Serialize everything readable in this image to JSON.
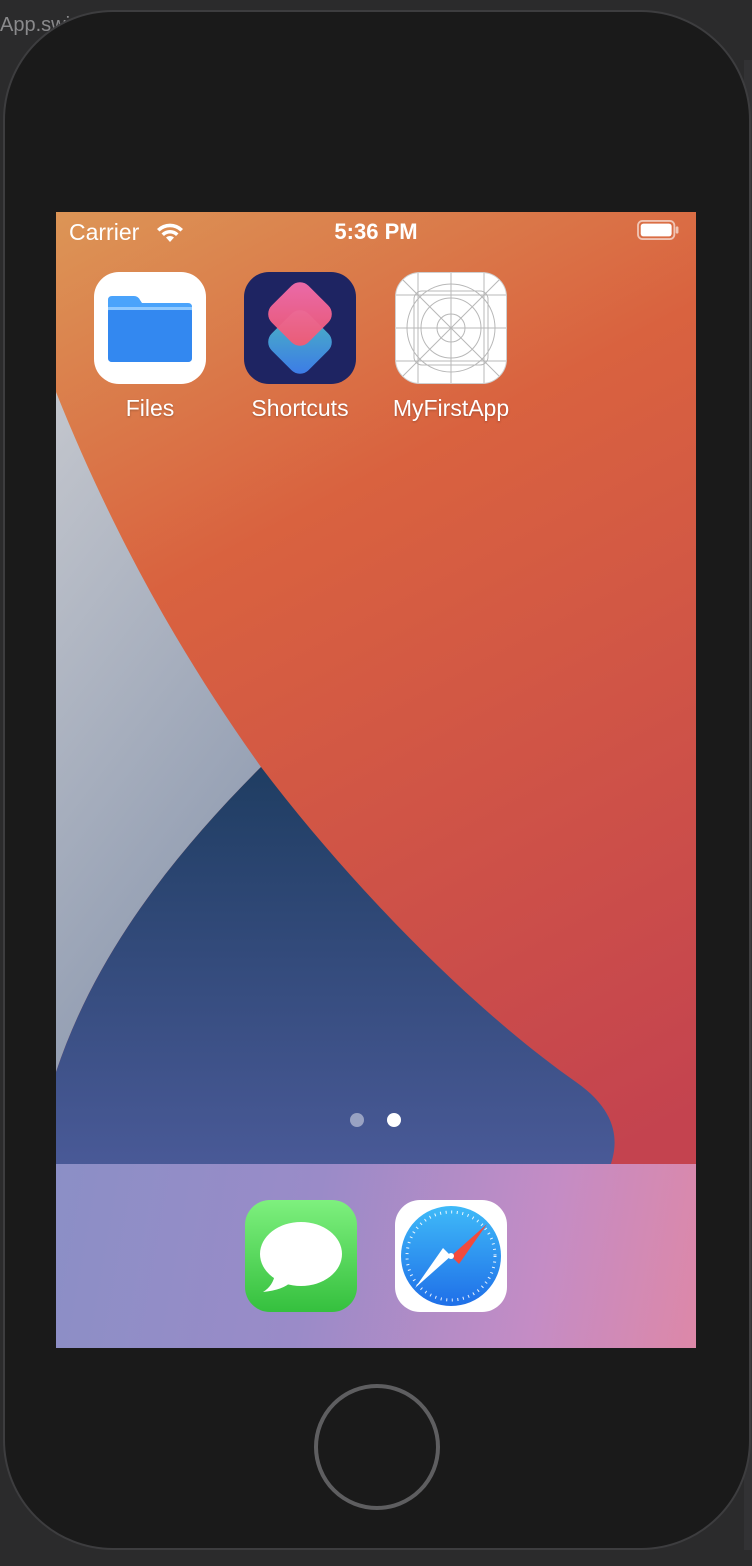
{
  "ide": {
    "tab_fragment": "App.swi"
  },
  "status_bar": {
    "carrier": "Carrier",
    "time": "5:36 PM",
    "wifi_icon": "wifi-icon",
    "battery_icon": "battery-icon"
  },
  "home_screen": {
    "apps": [
      {
        "label": "Files",
        "icon": "folder-icon"
      },
      {
        "label": "Shortcuts",
        "icon": "shortcuts-icon"
      },
      {
        "label": "MyFirstApp",
        "icon": "app-placeholder-icon"
      }
    ],
    "page_indicator": {
      "pages": 2,
      "current": 2
    }
  },
  "dock": {
    "apps": [
      {
        "name": "Messages",
        "icon": "messages-icon"
      },
      {
        "name": "Safari",
        "icon": "compass-icon"
      }
    ]
  },
  "device": {
    "home_button_icon": "home-button"
  },
  "colors": {
    "wallpaper_orange": "#d96a3c",
    "wallpaper_red": "#c9474a",
    "wallpaper_blue": "#2c4c78",
    "wallpaper_grey": "#aab3c4",
    "files_blue": "#3c8ef5",
    "messages_green": "#4fd25c",
    "safari_blue": "#2d8ef0"
  }
}
